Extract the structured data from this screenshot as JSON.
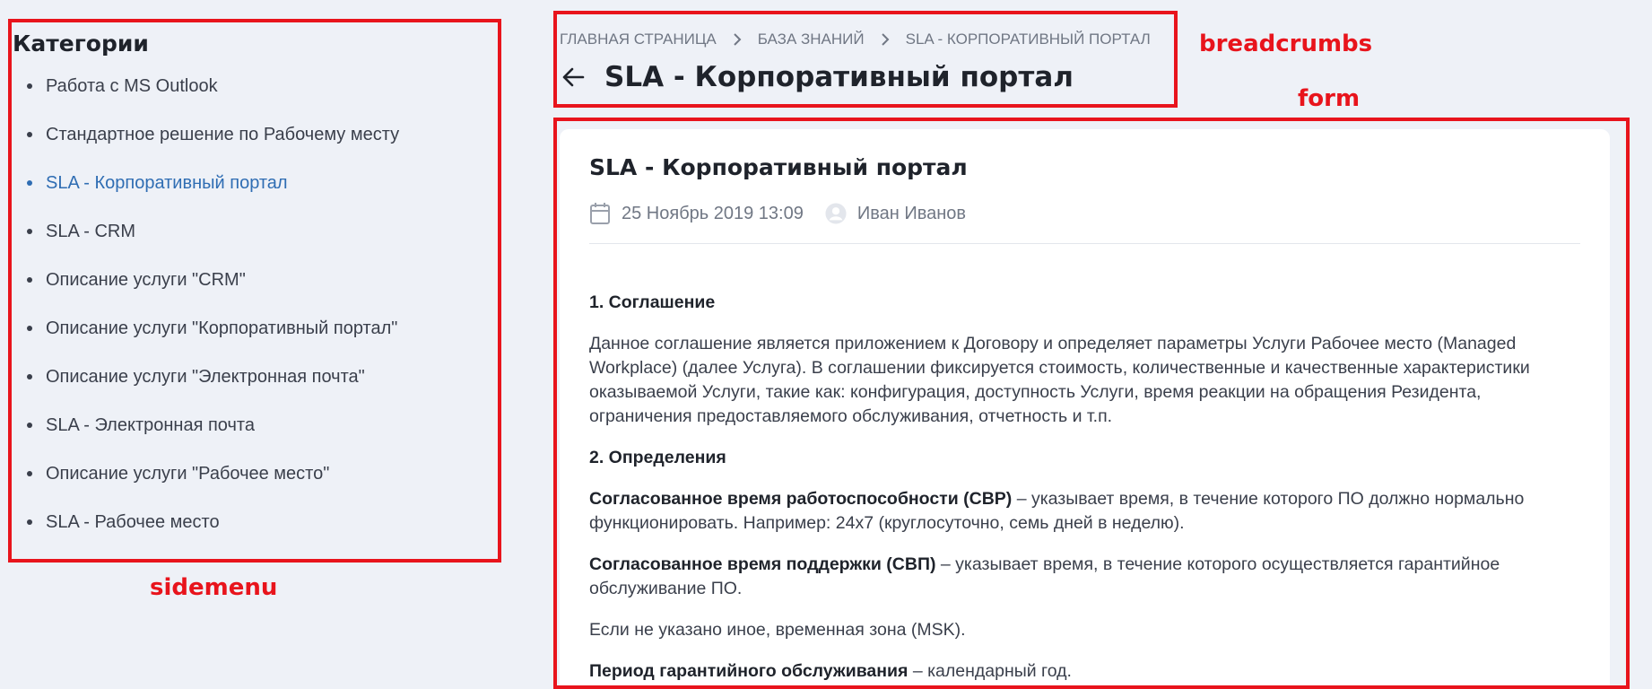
{
  "annotations": {
    "breadcrumbs": "breadcrumbs",
    "form": "form",
    "sidemenu": "sidemenu",
    "color": "#e8141c"
  },
  "sidemenu": {
    "title": "Категории",
    "items": [
      {
        "label": "Работа с MS Outlook",
        "active": false
      },
      {
        "label": "Стандартное решение по Рабочему месту",
        "active": false
      },
      {
        "label": "SLA - Корпоративный портал",
        "active": true
      },
      {
        "label": "SLA - CRM",
        "active": false
      },
      {
        "label": "Описание услуги \"CRM\"",
        "active": false
      },
      {
        "label": "Описание услуги \"Корпоративный портал\"",
        "active": false
      },
      {
        "label": "Описание услуги \"Электронная почта\"",
        "active": false
      },
      {
        "label": "SLA - Электронная почта",
        "active": false
      },
      {
        "label": "Описание услуги \"Рабочее место\"",
        "active": false
      },
      {
        "label": "SLA - Рабочее место",
        "active": false
      }
    ]
  },
  "breadcrumbs": {
    "items": [
      "Главная страница",
      "База знаний",
      "SLA - Корпоративный портал"
    ],
    "separator_icon": "chevron-right-icon",
    "back_icon": "arrow-left-icon",
    "page_title": "SLA - Корпоративный портал"
  },
  "article": {
    "title": "SLA - Корпоративный портал",
    "date": "25 Ноябрь 2019 13:09",
    "date_icon": "calendar-icon",
    "author": "Иван Иванов",
    "author_icon": "avatar-icon",
    "sections": {
      "s1_heading": "1. Соглашение",
      "s1_text": "Данное соглашение является приложением к Договору и определяет параметры Услуги Рабочее место (Managed Workplace) (далее Услуга). В соглашении фиксируется стоимость, количественные и качественные характеристики оказываемой Услуги, такие как: конфигурация, доступность Услуги, время реакции на обращения Резидента, ограничения предоставляемого обслуживания, отчетность и т.п.",
      "s2_heading": "2. Определения",
      "d1_term": "Согласованное время работоспособности (СВР)",
      "d1_text": " – указывает время, в течение которого ПО должно нормально функционировать. Например: 24х7 (круглосуточно, семь дней в неделю).",
      "d2_term": "Согласованное время поддержки (СВП)",
      "d2_text": " – указывает время, в течение которого осуществляется гарантийное обслуживание ПО.",
      "note": "Если не указано иное, временная зона (MSK).",
      "d3_term": "Период гарантийного обслуживания",
      "d3_text": " – календарный год."
    }
  }
}
